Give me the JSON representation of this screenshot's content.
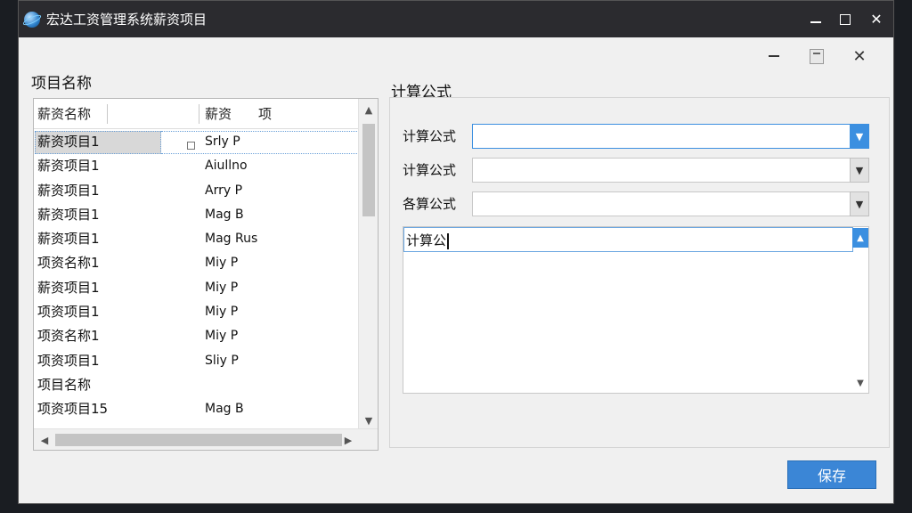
{
  "window": {
    "title": "宏达工资管理系统薪资项目",
    "app_icon": "globe-icon",
    "controls": {
      "minimize": "–",
      "maximize": "☐",
      "close": "✕"
    }
  },
  "inner_controls": {
    "minimize": "–",
    "restore": "restore-icon",
    "close": "✕"
  },
  "left_panel": {
    "label": "项目名称",
    "columns": [
      "薪资名称",
      "薪资　　项"
    ],
    "rows": [
      {
        "name": "薪资项目1",
        "item": "Srly P",
        "selected": true
      },
      {
        "name": "薪资项目1",
        "item": "Aiullno"
      },
      {
        "name": "薪资项目1",
        "item": "Arry P"
      },
      {
        "name": "薪资项目1",
        "item": "Mag B"
      },
      {
        "name": "薪资项目1",
        "item": "Mag Rus"
      },
      {
        "name": "项资名称1",
        "item": "Miy P"
      },
      {
        "name": "薪资项目1",
        "item": "Miy P"
      },
      {
        "name": "项资项目1",
        "item": "Miy P"
      },
      {
        "name": "项资名称1",
        "item": "Miy P"
      },
      {
        "name": "项资项目1",
        "item": "Sliy P"
      },
      {
        "name": "项目名称",
        "item": ""
      },
      {
        "name": "项资项目15",
        "item": "Mag B"
      }
    ]
  },
  "right_panel": {
    "label": "计算公式",
    "fields": [
      {
        "label": "计算公式",
        "value": "",
        "focused": true
      },
      {
        "label": "计算公式",
        "value": ""
      },
      {
        "label": "各算公式",
        "value": ""
      }
    ],
    "memo_text": "计算公"
  },
  "footer": {
    "save_label": "保存"
  },
  "colors": {
    "accent": "#3b86d6",
    "titlebar": "#2b2b2f",
    "background": "#f0f0f0"
  }
}
